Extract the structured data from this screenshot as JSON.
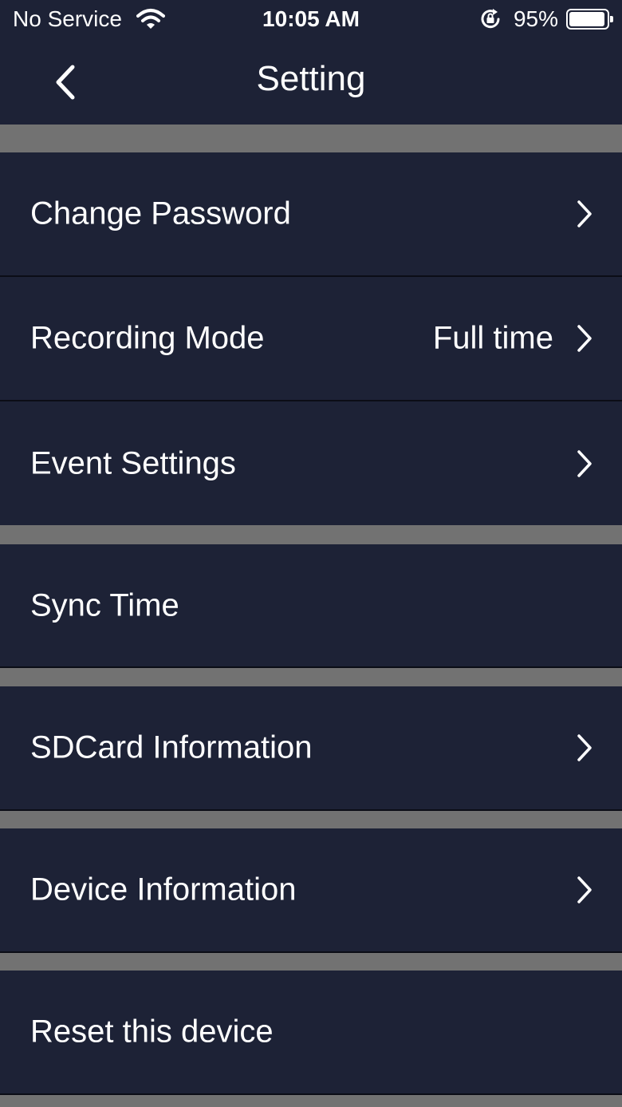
{
  "status_bar": {
    "carrier": "No Service",
    "time": "10:05 AM",
    "battery_percent": "95%",
    "battery_level": 0.95,
    "icons": [
      "wifi-icon",
      "orientation-lock-icon",
      "battery-icon"
    ]
  },
  "nav": {
    "title": "Setting",
    "back_icon": "chevron-left-icon"
  },
  "settings": {
    "change_password": {
      "label": "Change Password"
    },
    "recording_mode": {
      "label": "Recording Mode",
      "value": "Full time"
    },
    "event_settings": {
      "label": "Event Settings"
    },
    "sync_time": {
      "label": "Sync Time"
    },
    "sdcard_information": {
      "label": "SDCard Information"
    },
    "device_information": {
      "label": "Device Information"
    },
    "reset_device": {
      "label": "Reset this device"
    }
  },
  "colors": {
    "background": "#1d2236",
    "separator": "#727272",
    "text": "#ffffff"
  }
}
